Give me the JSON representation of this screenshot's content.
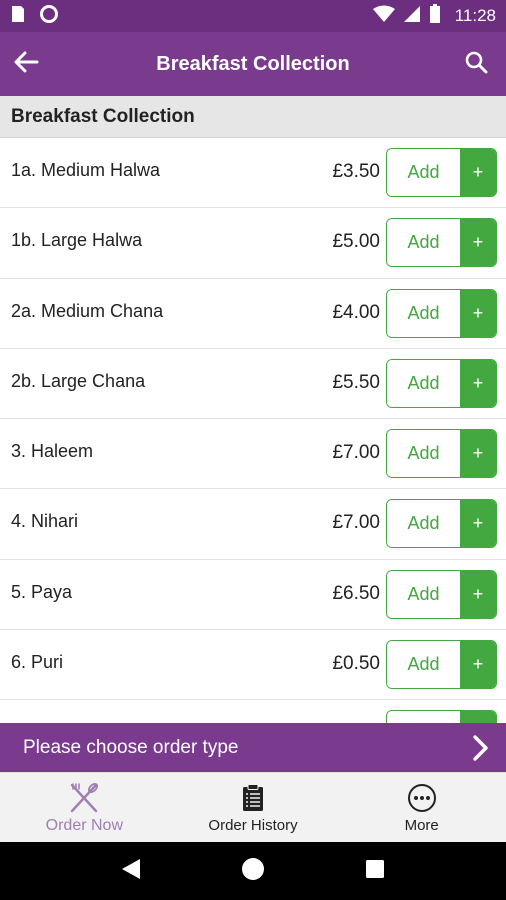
{
  "status_bar": {
    "time": "11:28",
    "icons": [
      "sim-card-icon",
      "circle-status-icon",
      "wifi-icon",
      "signal-icon",
      "battery-icon"
    ]
  },
  "app_bar": {
    "title": "Breakfast Collection",
    "back_icon": "arrow-left-icon",
    "search_icon": "search-icon"
  },
  "section": {
    "header": "Breakfast Collection"
  },
  "menu": {
    "add_label": "Add",
    "plus_label": "+",
    "items": [
      {
        "name": "1a. Medium Halwa",
        "price": "£3.50"
      },
      {
        "name": "1b. Large Halwa",
        "price": "£5.00"
      },
      {
        "name": "2a. Medium Chana",
        "price": "£4.00"
      },
      {
        "name": "2b. Large Chana",
        "price": "£5.50"
      },
      {
        "name": "3. Haleem",
        "price": "£7.00"
      },
      {
        "name": "4. Nihari",
        "price": "£7.00"
      },
      {
        "name": "5. Paya",
        "price": "£6.50"
      },
      {
        "name": "6. Puri",
        "price": "£0.50"
      },
      {
        "name": "",
        "price": ""
      }
    ]
  },
  "order_type": {
    "label": "Please choose order type",
    "icon": "chevron-right-icon"
  },
  "bottom_nav": {
    "items": [
      {
        "label": "Order Now",
        "icon": "fork-knife-icon",
        "active": true
      },
      {
        "label": "Order History",
        "icon": "clipboard-icon",
        "active": false
      },
      {
        "label": "More",
        "icon": "more-dots-icon",
        "active": false
      }
    ]
  },
  "colors": {
    "status_bar": "#6c2f80",
    "primary": "#7a3b8e",
    "accent_green": "#43a83f",
    "active_nav": "#9f7fb0"
  }
}
